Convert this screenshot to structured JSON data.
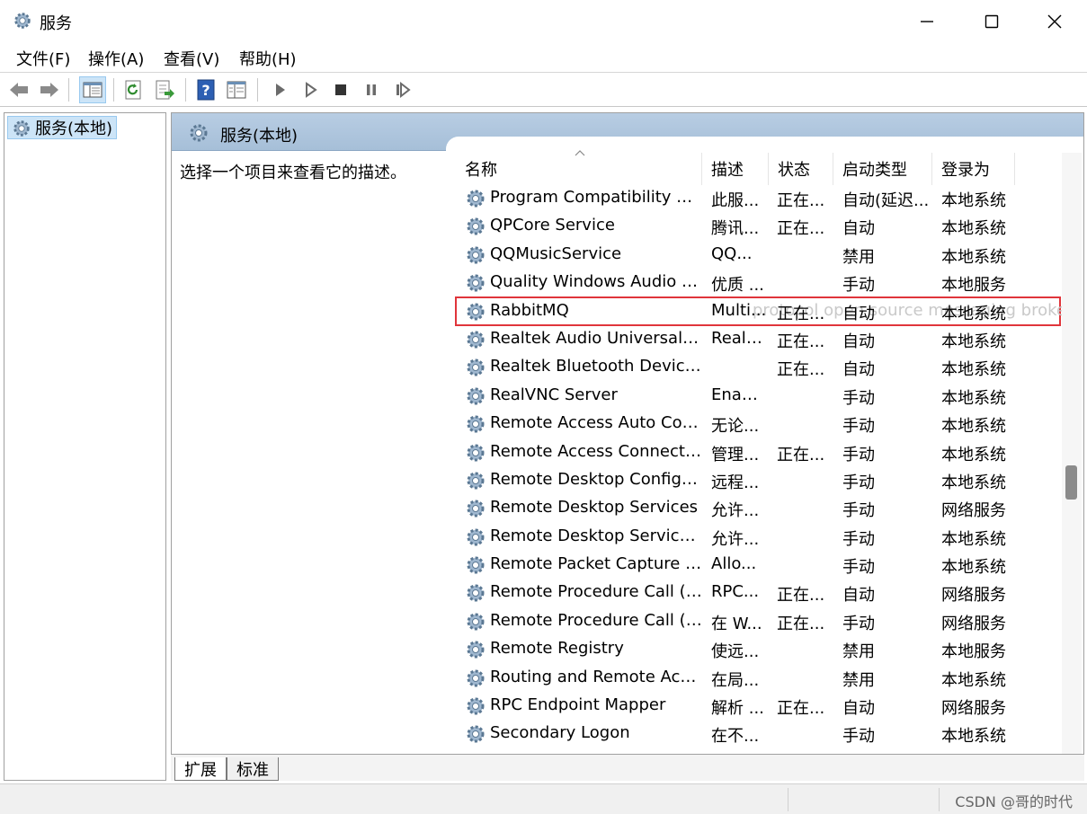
{
  "window": {
    "title": "服务"
  },
  "menu": [
    "文件(F)",
    "操作(A)",
    "查看(V)",
    "帮助(H)"
  ],
  "tree": {
    "item": "服务(本地)"
  },
  "panel": {
    "title": "服务(本地)",
    "description_prompt": "选择一个项目来查看它的描述。"
  },
  "columns": {
    "name": "名称",
    "desc": "描述",
    "status": "状态",
    "startup": "启动类型",
    "logon": "登录为"
  },
  "services": [
    {
      "name": "Program Compatibility Assi...",
      "desc": "此服...",
      "status": "正在...",
      "startup": "自动(延迟...",
      "logon": "本地系统"
    },
    {
      "name": "QPCore Service",
      "desc": "腾讯...",
      "status": "正在...",
      "startup": "自动",
      "logon": "本地系统"
    },
    {
      "name": "QQMusicService",
      "desc": "QQ...",
      "status": "",
      "startup": "禁用",
      "logon": "本地系统"
    },
    {
      "name": "Quality Windows Audio Vi...",
      "desc": "优质 ...",
      "status": "",
      "startup": "手动",
      "logon": "本地服务"
    },
    {
      "name": "RabbitMQ",
      "desc": "Multi...",
      "status": "正在...",
      "startup": "自动",
      "logon": "本地系统",
      "tooltip": "protocol open source messaging broker"
    },
    {
      "name": "Realtek Audio Universal Se...",
      "desc": "Realt...",
      "status": "正在...",
      "startup": "自动",
      "logon": "本地系统"
    },
    {
      "name": "Realtek Bluetooth Device ...",
      "desc": "",
      "status": "正在...",
      "startup": "自动",
      "logon": "本地系统"
    },
    {
      "name": "RealVNC Server",
      "desc": "Enab...",
      "status": "",
      "startup": "手动",
      "logon": "本地系统"
    },
    {
      "name": "Remote Access Auto Conn...",
      "desc": "无论...",
      "status": "",
      "startup": "手动",
      "logon": "本地系统"
    },
    {
      "name": "Remote Access Connectio...",
      "desc": "管理...",
      "status": "正在...",
      "startup": "手动",
      "logon": "本地系统"
    },
    {
      "name": "Remote Desktop Configur...",
      "desc": "远程...",
      "status": "",
      "startup": "手动",
      "logon": "本地系统"
    },
    {
      "name": "Remote Desktop Services",
      "desc": "允许...",
      "status": "",
      "startup": "手动",
      "logon": "网络服务"
    },
    {
      "name": "Remote Desktop Services ...",
      "desc": "允许...",
      "status": "",
      "startup": "手动",
      "logon": "本地系统"
    },
    {
      "name": "Remote Packet Capture Pr...",
      "desc": "Allo...",
      "status": "",
      "startup": "手动",
      "logon": "本地系统"
    },
    {
      "name": "Remote Procedure Call (R...",
      "desc": "RPC...",
      "status": "正在...",
      "startup": "自动",
      "logon": "网络服务"
    },
    {
      "name": "Remote Procedure Call (R...",
      "desc": "在 W...",
      "status": "正在...",
      "startup": "手动",
      "logon": "网络服务"
    },
    {
      "name": "Remote Registry",
      "desc": "使远...",
      "status": "",
      "startup": "禁用",
      "logon": "本地服务"
    },
    {
      "name": "Routing and Remote Access",
      "desc": "在局...",
      "status": "",
      "startup": "禁用",
      "logon": "本地系统"
    },
    {
      "name": "RPC Endpoint Mapper",
      "desc": "解析 ...",
      "status": "正在...",
      "startup": "自动",
      "logon": "网络服务"
    },
    {
      "name": "Secondary Logon",
      "desc": "在不...",
      "status": "",
      "startup": "手动",
      "logon": "本地系统"
    }
  ],
  "highlighted_service": "RabbitMQ",
  "tabs": {
    "extended": "扩展",
    "standard": "标准"
  },
  "watermark": "CSDN @哥的时代",
  "icons": [
    "gear-icon",
    "back-arrow-icon",
    "forward-arrow-icon",
    "console-tree-icon",
    "refresh-icon",
    "export-icon",
    "help-icon",
    "properties-icon",
    "start-icon",
    "start-icon-alt",
    "stop-icon",
    "pause-icon",
    "resume-icon",
    "minimize-icon",
    "maximize-icon",
    "close-icon"
  ]
}
